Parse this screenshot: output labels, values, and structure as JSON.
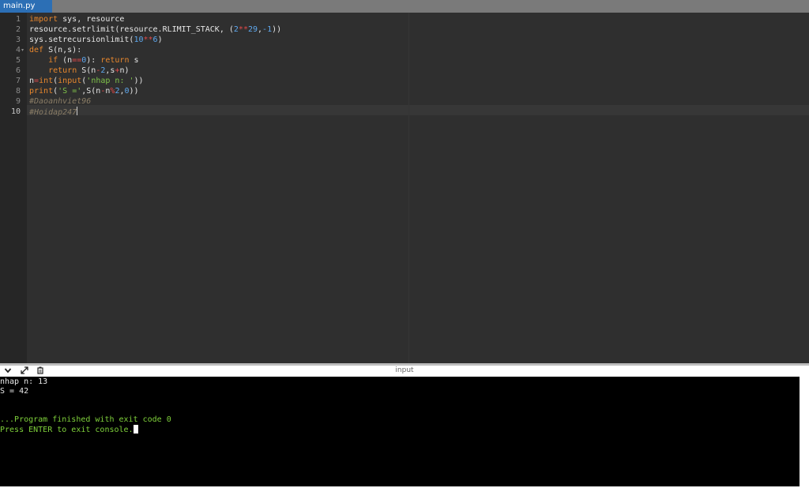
{
  "tab": {
    "label": "main.py"
  },
  "editor": {
    "line_numbers": [
      "1",
      "2",
      "3",
      "4",
      "5",
      "6",
      "7",
      "8",
      "9",
      "10"
    ],
    "lines": [
      [
        {
          "t": "import",
          "c": "kw"
        },
        {
          "t": " sys, resource",
          "c": ""
        }
      ],
      [
        {
          "t": "resource.setrlimit(resource.RLIMIT_STACK, (",
          "c": ""
        },
        {
          "t": "2",
          "c": "num"
        },
        {
          "t": "**",
          "c": "op"
        },
        {
          "t": "29",
          "c": "num"
        },
        {
          "t": ",",
          "c": ""
        },
        {
          "t": "-1",
          "c": "num"
        },
        {
          "t": "))",
          "c": ""
        }
      ],
      [
        {
          "t": "sys.setrecursionlimit(",
          "c": ""
        },
        {
          "t": "10",
          "c": "num"
        },
        {
          "t": "**",
          "c": "op"
        },
        {
          "t": "6",
          "c": "num"
        },
        {
          "t": ")",
          "c": ""
        }
      ],
      [
        {
          "t": "def",
          "c": "kw"
        },
        {
          "t": " S(n,s):",
          "c": ""
        }
      ],
      [
        {
          "t": "    ",
          "c": ""
        },
        {
          "t": "if",
          "c": "kw"
        },
        {
          "t": " (n",
          "c": ""
        },
        {
          "t": "==",
          "c": "op"
        },
        {
          "t": "0",
          "c": "num"
        },
        {
          "t": "): ",
          "c": ""
        },
        {
          "t": "return",
          "c": "kw"
        },
        {
          "t": " s",
          "c": ""
        }
      ],
      [
        {
          "t": "    ",
          "c": ""
        },
        {
          "t": "return",
          "c": "kw"
        },
        {
          "t": " S(n",
          "c": ""
        },
        {
          "t": "-",
          "c": "op"
        },
        {
          "t": "2",
          "c": "num"
        },
        {
          "t": ",s",
          "c": ""
        },
        {
          "t": "+",
          "c": "op"
        },
        {
          "t": "n)",
          "c": ""
        }
      ],
      [
        {
          "t": "n",
          "c": ""
        },
        {
          "t": "=",
          "c": "op"
        },
        {
          "t": "int",
          "c": "bi"
        },
        {
          "t": "(",
          "c": ""
        },
        {
          "t": "input",
          "c": "bi"
        },
        {
          "t": "(",
          "c": ""
        },
        {
          "t": "'nhap n: '",
          "c": "str"
        },
        {
          "t": "))",
          "c": ""
        }
      ],
      [
        {
          "t": "print",
          "c": "bi"
        },
        {
          "t": "(",
          "c": ""
        },
        {
          "t": "'S ='",
          "c": "str"
        },
        {
          "t": ",S(n",
          "c": ""
        },
        {
          "t": "-",
          "c": "op"
        },
        {
          "t": "n",
          "c": ""
        },
        {
          "t": "%",
          "c": "op"
        },
        {
          "t": "2",
          "c": "num"
        },
        {
          "t": ",",
          "c": ""
        },
        {
          "t": "0",
          "c": "num"
        },
        {
          "t": "))",
          "c": ""
        }
      ],
      [
        {
          "t": "#Daoanhviet96",
          "c": "cm"
        }
      ],
      [
        {
          "t": "#Hoidap247",
          "c": "cm"
        }
      ]
    ],
    "active_line": 10,
    "fold_marker": "▾"
  },
  "console_bar": {
    "title": "input",
    "collapse_icon": "chevron-down-icon",
    "expand_icon": "expand-icon",
    "settings_icon": "settings-icon"
  },
  "console": {
    "lines": [
      {
        "text": "nhap n: 13",
        "color": "#e8e8e8"
      },
      {
        "text": "S = 42",
        "color": "#e8e8e8"
      },
      {
        "text": "",
        "color": "#e8e8e8"
      },
      {
        "text": "",
        "color": "#e8e8e8"
      },
      {
        "text": "...Program finished with exit code 0",
        "color": "#7fd13b"
      },
      {
        "text": "Press ENTER to exit console.",
        "color": "#7fd13b"
      }
    ]
  }
}
